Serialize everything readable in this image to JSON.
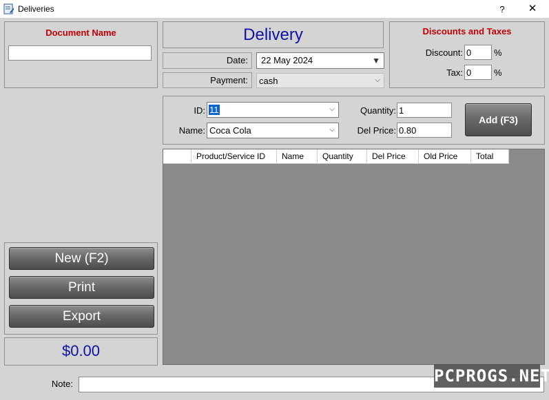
{
  "window": {
    "title": "Deliveries",
    "help": "?",
    "close": "✕"
  },
  "doc_panel": {
    "title": "Document Name",
    "value": ""
  },
  "header": {
    "title": "Delivery"
  },
  "date": {
    "label": "Date:",
    "value": "22 May 2024"
  },
  "payment": {
    "label": "Payment:",
    "value": "cash"
  },
  "discounts": {
    "title": "Discounts and Taxes",
    "discount_label": "Discount:",
    "discount_value": "0",
    "discount_unit": "%",
    "tax_label": "Tax:",
    "tax_value": "0",
    "tax_unit": "%"
  },
  "entry": {
    "id_label": "ID:",
    "id_value": "11",
    "name_label": "Name:",
    "name_value": "Coca Cola",
    "qty_label": "Quantity:",
    "qty_value": "1",
    "price_label": "Del Price:",
    "price_value": "0.80",
    "add_label": "Add (F3)"
  },
  "grid": {
    "columns": [
      "",
      "Product/Service ID",
      "Name",
      "Quantity",
      "Del Price",
      "Old Price",
      "Total"
    ],
    "rows": []
  },
  "actions": {
    "new": "New (F2)",
    "print": "Print",
    "export": "Export"
  },
  "total": "$0.00",
  "note": {
    "label": "Note:",
    "value": ""
  },
  "watermark": "PCPROGS.NET",
  "colors": {
    "accent_red": "#c00000",
    "accent_blue": "#1010a8",
    "grid_bg": "#8a8a8a"
  }
}
